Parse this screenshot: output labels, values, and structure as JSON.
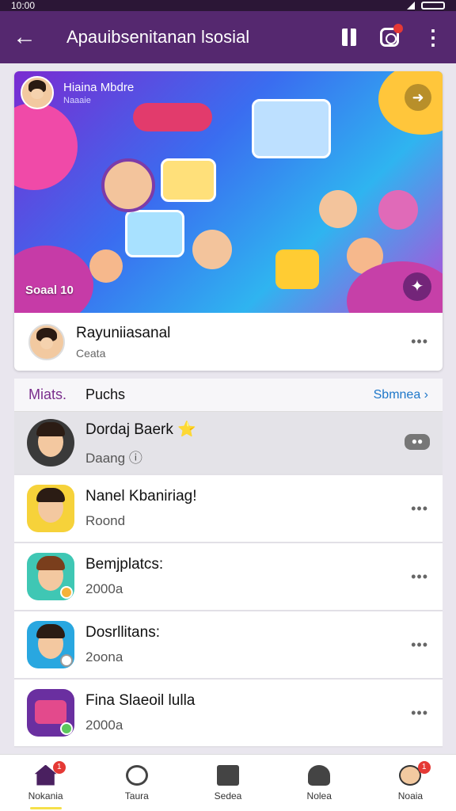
{
  "status_bar": {
    "time": "10:00"
  },
  "app_bar": {
    "title": "Apauibsenitanan lsosial"
  },
  "hero": {
    "user_name": "Hiaina Mbdre",
    "user_sub": "Naaaie",
    "badge": "Soaal 10",
    "poster_name": "Rayuniiasanal",
    "poster_status": "Ceata"
  },
  "list": {
    "tab_active": "Miats.",
    "tab_other": "Puchs",
    "see_all": "Sbmnea",
    "items": [
      {
        "name": "Dordaj Baerk ⭐",
        "status": "Daang ⓘ",
        "badge": "●●"
      },
      {
        "name": "Nanel Kbaniriag!",
        "status": "Roond"
      },
      {
        "name": "Bemjplatcs:",
        "status": "2000a"
      },
      {
        "name": "Dosrllitans:",
        "status": "2oona"
      },
      {
        "name": "Fina Slaeoil lulla",
        "status": "2000a"
      }
    ]
  },
  "bottom_nav": [
    {
      "label": "Nokania",
      "badge": "1"
    },
    {
      "label": "Taura"
    },
    {
      "label": "Sedea"
    },
    {
      "label": "Nolea"
    },
    {
      "label": "Noaia",
      "badge": "1"
    }
  ],
  "colors": {
    "app_bar": "#55286f",
    "link": "#1e77c9",
    "accent": "#7a2e8c",
    "notification": "#e53935"
  }
}
